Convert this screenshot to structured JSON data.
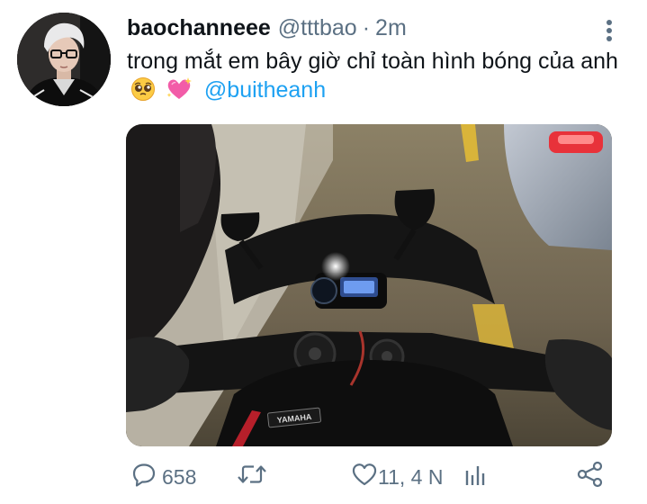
{
  "tweet": {
    "display_name": "baochanneee",
    "handle": "@tttbao",
    "separator": "·",
    "time": "2m",
    "text": "trong mắt em bây giờ chỉ toàn hình bóng của anh",
    "emojis": [
      "pleading-face-emoji",
      "sparkling-heart-emoji"
    ],
    "mention": "@buitheanh",
    "media_label": "YAMAHA"
  },
  "actions": {
    "reply_count": "658",
    "retweet_count": "",
    "like_count": "11, 4 N",
    "icons": [
      "reply-icon",
      "retweet-icon",
      "like-icon",
      "analytics-icon",
      "share-icon"
    ]
  },
  "colors": {
    "text": "#0f1419",
    "secondary": "#5b7083",
    "link": "#1da1f2"
  }
}
